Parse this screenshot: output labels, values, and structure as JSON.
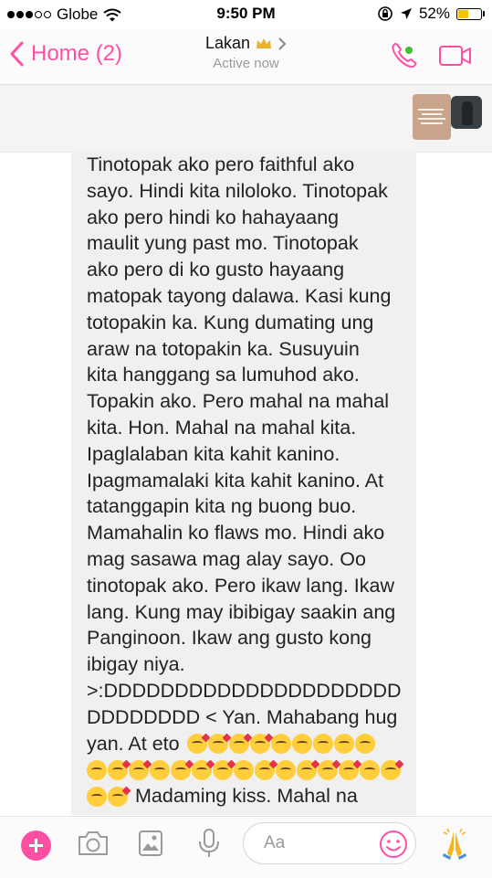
{
  "status_bar": {
    "carrier": "Globe",
    "time": "9:50 PM",
    "battery_percent": "52%",
    "battery_level": 0.52,
    "signal_bars_filled": 3,
    "signal_bars_total": 5
  },
  "header": {
    "back_label": "Home (2)",
    "contact_name": "Lakan",
    "contact_status": "Active now",
    "accent_color": "#ff4fa3"
  },
  "message": {
    "lines": [
      "Tinotopak ako pero faithful ako",
      "sayo. Hindi kita niloloko. Tinotopak",
      "ako pero hindi ko hahayaang",
      "maulit yung past mo. Tinotopak",
      "ako pero di ko gusto hayaang",
      "matopak tayong dalawa. Kasi kung",
      "totopakin ka. Kung dumating ung",
      "araw na totopakin ka. Susuyuin",
      "kita hanggang sa lumuhod ako.",
      "Topakin ako. Pero mahal na mahal",
      "kita. Hon. Mahal na mahal kita.",
      "Ipaglalaban kita kahit kanino.",
      "Ipagmamalaki kita kahit kanino. At",
      "tatanggapin kita ng buong buo.",
      "Mamahalin ko flaws mo. Hindi ako",
      "mag sasawa mag alay sayo. Oo",
      "tinotopak ako. Pero ikaw lang. Ikaw",
      "lang. Kung may ibibigay saakin ang",
      "Panginoon. Ikaw ang gusto kong",
      "ibigay niya.",
      ">:DDDDDDDDDDDDDDDDDDDDD",
      "DDDDDDDD < Yan. Mahabang hug"
    ],
    "emoji_line_prefix": "yan. At eto",
    "last_line_text": "Madaming kiss. Mahal na",
    "emoji_icon": "kissing-face-emoji"
  },
  "composer": {
    "placeholder": "Aa"
  }
}
